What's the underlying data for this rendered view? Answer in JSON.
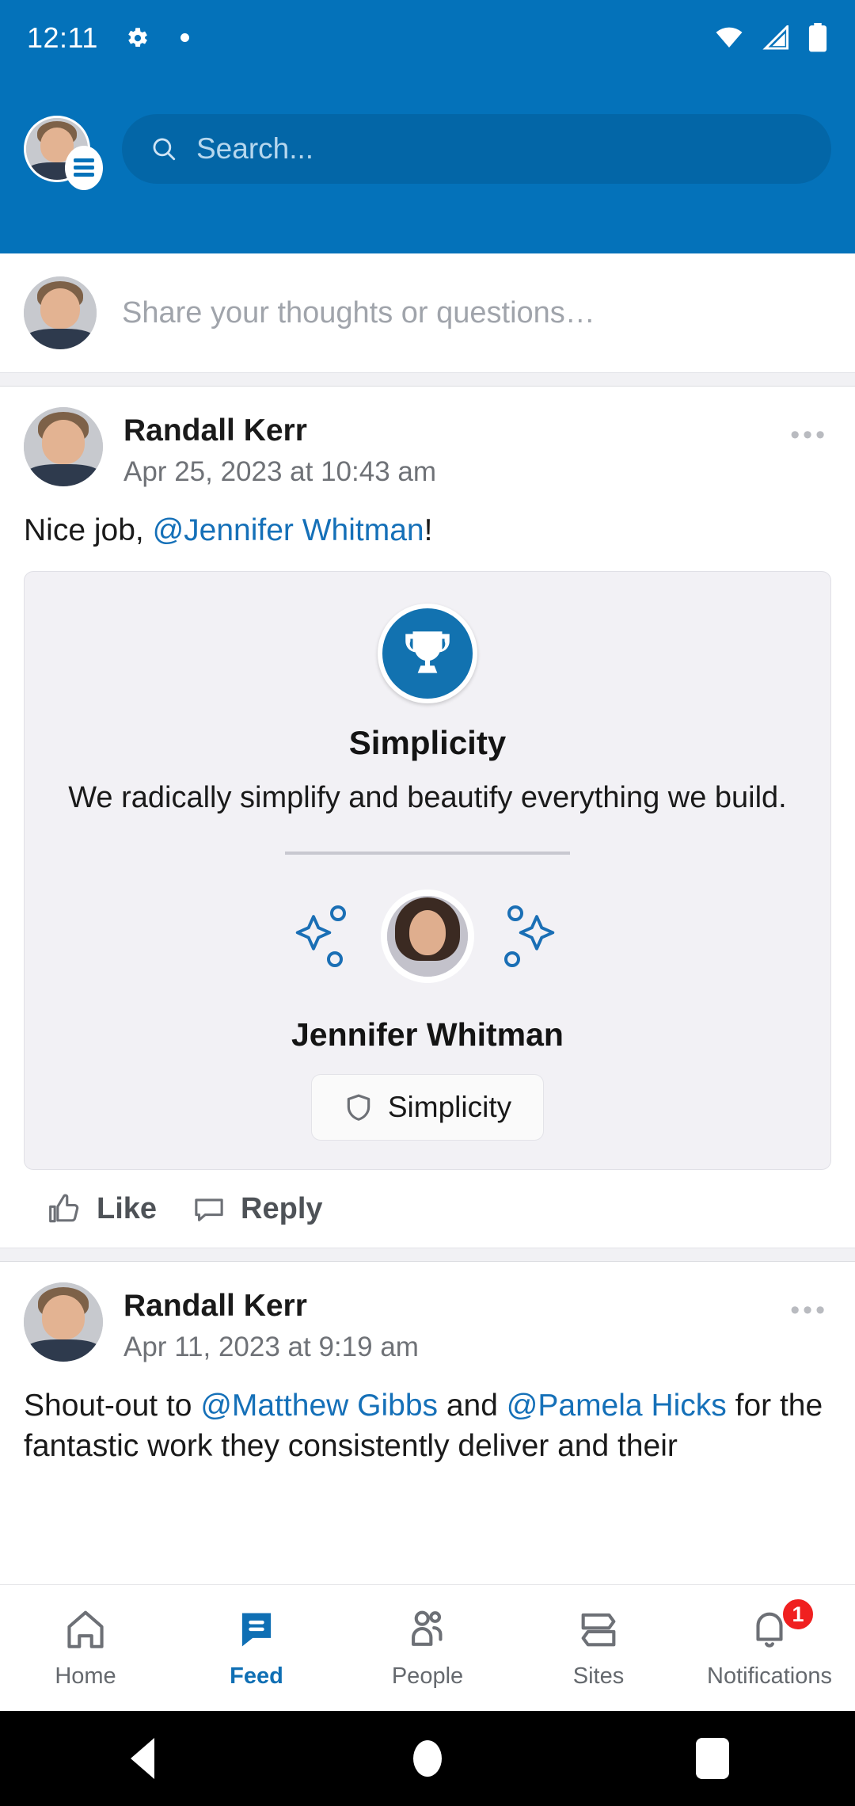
{
  "status_bar": {
    "time": "12:11",
    "icons": [
      "gear-icon",
      "dot-indicator",
      "wifi-icon",
      "cellular-signal-icon",
      "battery-icon"
    ]
  },
  "header": {
    "search_placeholder": "Search...",
    "avatar_alt": "Randall Kerr",
    "menu_badge": "hamburger-menu-icon"
  },
  "composer": {
    "placeholder": "Share your thoughts or questions…"
  },
  "posts": [
    {
      "author": "Randall Kerr",
      "date": "Apr 25, 2023 at 10:43 am",
      "text_before": "Nice job, ",
      "mention": "@Jennifer Whitman",
      "text_after": "!",
      "more_label": "•••",
      "award": {
        "icon": "trophy-icon",
        "title": "Simplicity",
        "description": "We radically simplify and beautify everything we build.",
        "recipient_name": "Jennifer Whitman",
        "badge_label": "Simplicity",
        "badge_icon": "shield-icon"
      },
      "actions": {
        "like": "Like",
        "reply": "Reply"
      }
    },
    {
      "author": "Randall Kerr",
      "date": "Apr 11, 2023 at 9:19 am",
      "more_label": "•••",
      "text_1": "Shout-out to ",
      "mention_1": "@Matthew Gibbs",
      "text_2": " and ",
      "mention_2": "@Pamela Hicks",
      "text_3": " for the fantastic work they consistently deliver and their"
    }
  ],
  "bottom_nav": {
    "items": [
      {
        "label": "Home",
        "icon": "home-icon",
        "active": false
      },
      {
        "label": "Feed",
        "icon": "feed-chat-icon",
        "active": true
      },
      {
        "label": "People",
        "icon": "people-icon",
        "active": false
      },
      {
        "label": "Sites",
        "icon": "sites-icon",
        "active": false
      },
      {
        "label": "Notifications",
        "icon": "bell-icon",
        "active": false,
        "badge": "1"
      }
    ]
  },
  "system_nav": {
    "back": "back-triangle-icon",
    "home": "home-circle-icon",
    "recents": "recents-square-icon"
  },
  "colors": {
    "header_blue": "#0472BA",
    "accent_blue": "#0f6fb4",
    "mention_blue": "#1570b8",
    "badge_red": "#f02020",
    "card_bg": "#f2f1f5"
  }
}
